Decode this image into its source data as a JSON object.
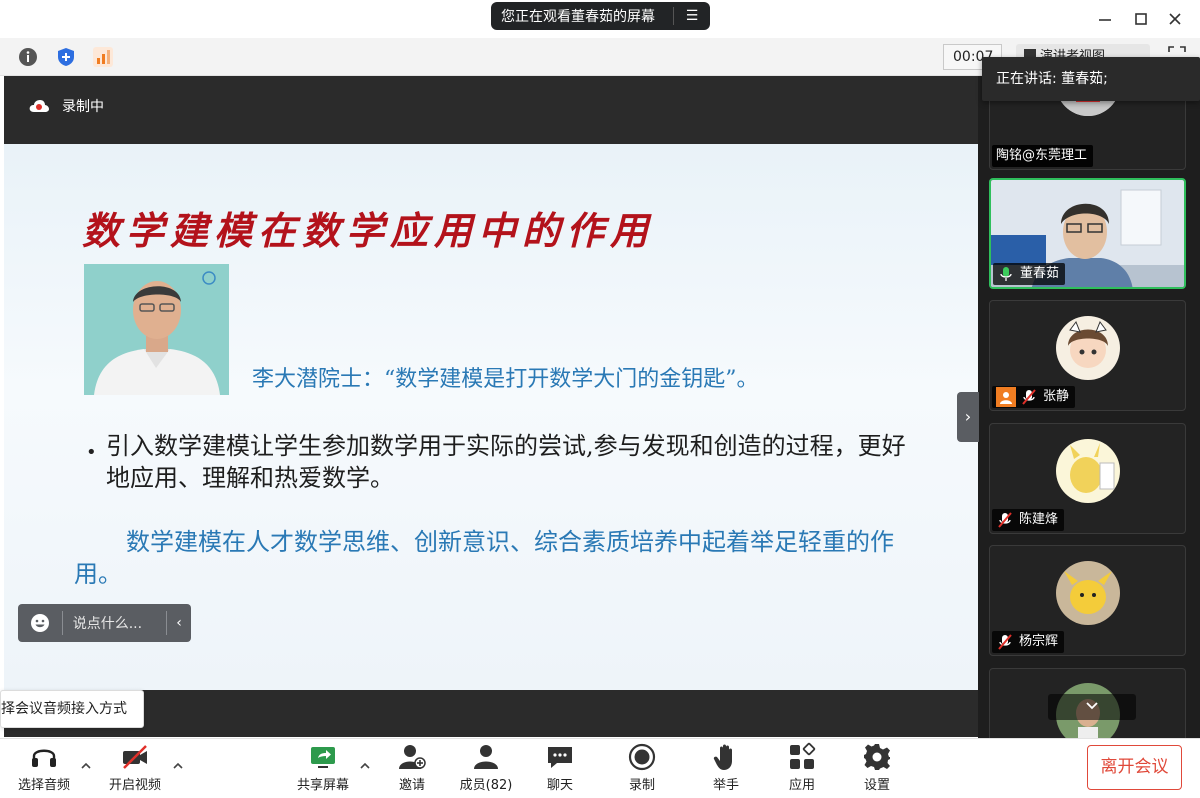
{
  "titlebar": {
    "sharing_text": "您正在观看董春茹的屏幕",
    "menu_glyph": "☰"
  },
  "toolbar": {
    "timer": "00:07",
    "presenter_view": "演讲者视图"
  },
  "recording": {
    "label": "录制中"
  },
  "slide": {
    "title": "数学建模在数学应用中的作用",
    "quote": "李大潜院士：“数学建模是打开数学大门的金钥匙”。",
    "bullet": "引入数学建模让学生参加数学用于实际的尝试,参与发现和创造的过程，更好地应用、理解和热爱数学。",
    "paragraph": "数学建模在人才数学思维、创新意识、综合素质培养中起着举足轻重的作用。"
  },
  "chat": {
    "placeholder": "说点什么..."
  },
  "tooltip": {
    "text": "选择会议音频接入方式"
  },
  "speaking": {
    "label": "正在讲话: 董春茹;"
  },
  "participants": [
    {
      "name": "陶铭@东莞理工"
    },
    {
      "name": "董春茹"
    },
    {
      "name": "张静"
    },
    {
      "name": "陈建烽"
    },
    {
      "name": "杨宗辉"
    }
  ],
  "bottombar": {
    "audio": "选择音频",
    "video": "开启视频",
    "share": "共享屏幕",
    "invite": "邀请",
    "members": "成员(82)",
    "chat": "聊天",
    "record": "录制",
    "raise_hand": "举手",
    "apps": "应用",
    "settings": "设置",
    "leave": "离开会议"
  },
  "colors": {
    "accent_red": "#b3121b",
    "slide_blue": "#2a79b5",
    "active_green": "#2fbf5c",
    "leave_red": "#e0493a"
  }
}
